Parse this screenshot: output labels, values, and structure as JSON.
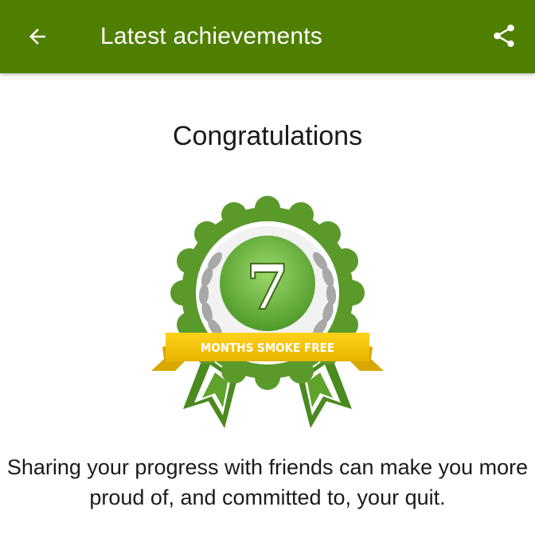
{
  "app_bar": {
    "title": "Latest achievements",
    "back_icon": "arrow-left-icon",
    "share_icon": "share-icon",
    "color": "#4f7f00"
  },
  "heading": "Congratulations",
  "badge": {
    "number": "7",
    "ribbon_text": "MONTHS SMOKE FREE",
    "rosette_color": "#5a9a2a",
    "ribbon_color": "#f0c400"
  },
  "message": "Sharing your progress with friends can make you more proud of, and committed to, your quit."
}
